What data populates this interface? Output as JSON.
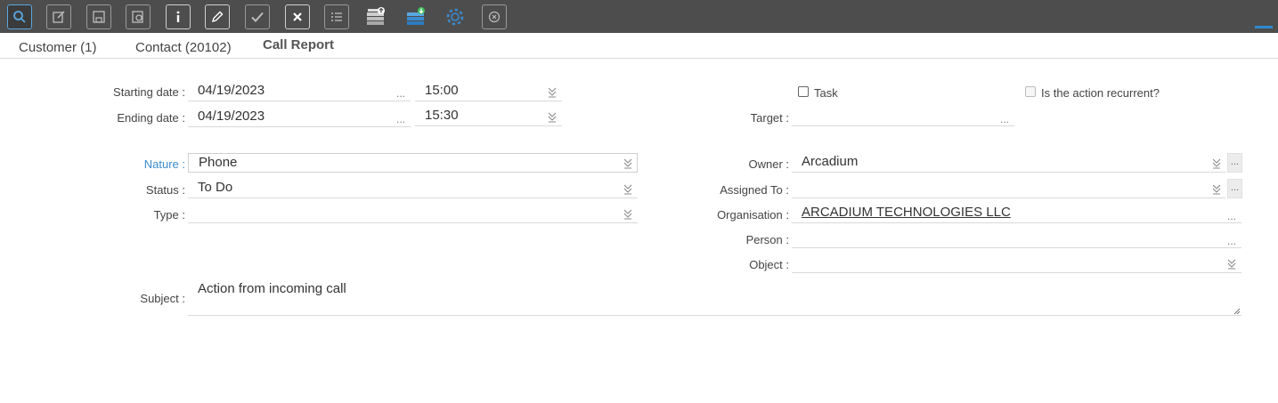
{
  "toolbar": {
    "buttons": [
      {
        "name": "search-icon"
      },
      {
        "name": "edit-icon"
      },
      {
        "name": "save-icon"
      },
      {
        "name": "copy-icon"
      },
      {
        "name": "info-icon"
      },
      {
        "name": "pencil-icon"
      },
      {
        "name": "check-icon"
      },
      {
        "name": "close-icon"
      },
      {
        "name": "list-icon"
      },
      {
        "name": "upload-icon"
      },
      {
        "name": "download-icon"
      },
      {
        "name": "gear-icon"
      },
      {
        "name": "cancel-icon"
      }
    ]
  },
  "tabs": [
    {
      "label": "Customer (1)"
    },
    {
      "label": "Contact (20102)"
    },
    {
      "label": "Call Report"
    }
  ],
  "form": {
    "starting_date": {
      "label": "Starting date :",
      "date": "04/19/2023",
      "time": "15:00"
    },
    "ending_date": {
      "label": "Ending date :",
      "date": "04/19/2023",
      "time": "15:30"
    },
    "task": {
      "label": "Task",
      "checked": false
    },
    "recurrent": {
      "label": "Is the action recurrent?",
      "checked": false
    },
    "target": {
      "label": "Target :",
      "value": ""
    },
    "nature": {
      "label": "Nature :",
      "value": "Phone"
    },
    "status": {
      "label": "Status :",
      "value": "To Do"
    },
    "type": {
      "label": "Type :",
      "value": ""
    },
    "owner": {
      "label": "Owner :",
      "value": "Arcadium"
    },
    "assigned_to": {
      "label": "Assigned To :",
      "value": ""
    },
    "organisation": {
      "label": "Organisation :",
      "value": "ARCADIUM TECHNOLOGIES LLC"
    },
    "person": {
      "label": "Person :",
      "value": ""
    },
    "object": {
      "label": "Object :",
      "value": ""
    },
    "subject": {
      "label": "Subject :",
      "value": "Action from incoming call"
    }
  },
  "ellipsis": "...",
  "colors": {
    "toolbar_bg": "#4d4d4d",
    "accent_blue": "#3b8bd1",
    "active_border": "#5aa7e0"
  }
}
